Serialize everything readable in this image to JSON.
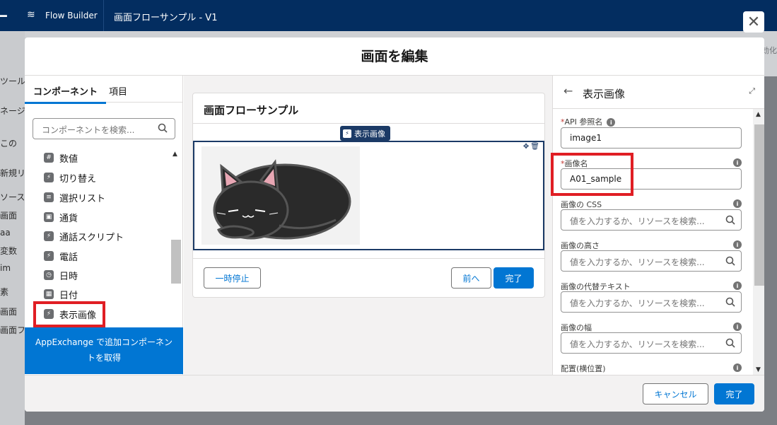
{
  "topbar": {
    "app_name": "Flow Builder",
    "flow_name": "画面フローサンプル - V1"
  },
  "background": {
    "left_texts": [
      "ツール",
      "ネージ",
      "この",
      "新規リ",
      "ソース",
      "画面",
      "aa",
      "変数",
      "im",
      "素",
      "画面",
      "画面フ"
    ],
    "right_text": "有効化"
  },
  "modal": {
    "title": "画面を編集",
    "footer": {
      "cancel_label": "キャンセル",
      "done_label": "完了"
    }
  },
  "left_pane": {
    "tabs": [
      {
        "label": "コンポーネント"
      },
      {
        "label": "項目"
      }
    ],
    "search_placeholder": "コンポーネントを検索...",
    "components": [
      {
        "label": "数値",
        "icon": "number-icon"
      },
      {
        "label": "切り替え",
        "icon": "toggle-icon"
      },
      {
        "label": "選択リスト",
        "icon": "picklist-icon"
      },
      {
        "label": "通貨",
        "icon": "currency-icon"
      },
      {
        "label": "通話スクリプト",
        "icon": "call-script-icon"
      },
      {
        "label": "電話",
        "icon": "phone-icon"
      },
      {
        "label": "日時",
        "icon": "datetime-icon"
      },
      {
        "label": "日付",
        "icon": "date-icon"
      },
      {
        "label": "表示画像",
        "icon": "display-image-icon"
      }
    ],
    "appexchange_label": "AppExchange で追加コンポーネントを取得"
  },
  "canvas": {
    "screen_title": "画面フローサンプル",
    "selected_badge": "表示画像",
    "pause_label": "一時停止",
    "prev_label": "前へ",
    "finish_label": "完了"
  },
  "properties": {
    "title": "表示画像",
    "fields": [
      {
        "label": "API 参照名",
        "required": true,
        "value": "image1",
        "placeholder": ""
      },
      {
        "label": "画像名",
        "required": true,
        "value": "A01_sample",
        "placeholder": ""
      },
      {
        "label": "画像の CSS",
        "required": false,
        "value": "",
        "placeholder": "値を入力するか、リソースを検索..."
      },
      {
        "label": "画像の高さ",
        "required": false,
        "value": "",
        "placeholder": "値を入力するか、リソースを検索..."
      },
      {
        "label": "画像の代替テキスト",
        "required": false,
        "value": "",
        "placeholder": "値を入力するか、リソースを検索..."
      },
      {
        "label": "画像の幅",
        "required": false,
        "value": "",
        "placeholder": "値を入力するか、リソースを検索..."
      },
      {
        "label": "配置(横位置)",
        "required": false,
        "value": "",
        "placeholder": ""
      }
    ]
  },
  "colors": {
    "brand": "#0176d3",
    "header": "#032d60",
    "highlight": "#e01e24",
    "selection": "#1b3a66"
  }
}
